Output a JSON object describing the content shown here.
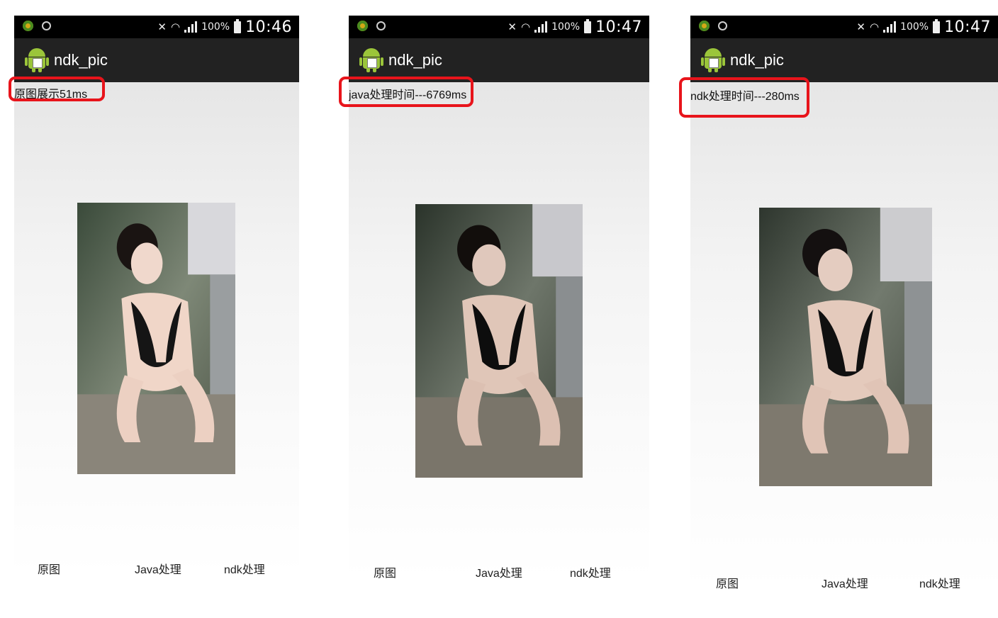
{
  "screens": [
    {
      "status": {
        "battery": "100%",
        "time": "10:46"
      },
      "app_title": "ndk_pic",
      "timing_label": "原图展示51ms",
      "buttons": {
        "original": "原图",
        "java": "Java处理",
        "ndk": "ndk处理"
      }
    },
    {
      "status": {
        "battery": "100%",
        "time": "10:47"
      },
      "app_title": "ndk_pic",
      "timing_label": "java处理时间---6769ms",
      "buttons": {
        "original": "原图",
        "java": "Java处理",
        "ndk": "ndk处理"
      }
    },
    {
      "status": {
        "battery": "100%",
        "time": "10:47"
      },
      "app_title": "ndk_pic",
      "timing_label": "ndk处理时间---280ms",
      "buttons": {
        "original": "原图",
        "java": "Java处理",
        "ndk": "ndk处理"
      }
    }
  ],
  "colors": {
    "highlight": "#e8141b",
    "status_bar": "#000000",
    "action_bar": "#222222",
    "android_green": "#9bc53a"
  },
  "icons": [
    "notification-icon",
    "android-logo-icon",
    "mute-icon",
    "wifi-icon",
    "signal-icon",
    "battery-icon"
  ]
}
